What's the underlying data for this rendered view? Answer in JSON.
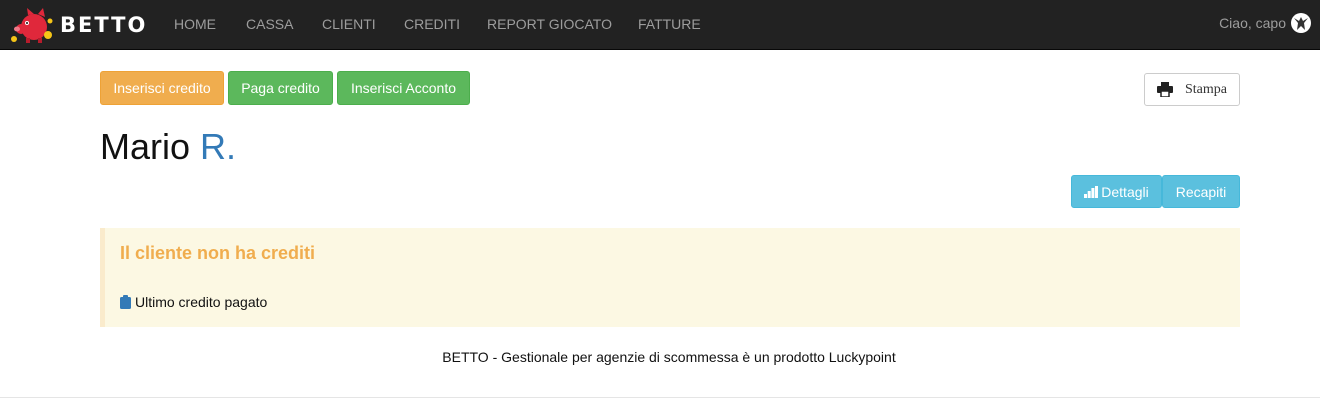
{
  "brand": {
    "name": "BETTO",
    "logo_icon": "pig-mascot-icon"
  },
  "nav": {
    "items": [
      {
        "label": "HOME"
      },
      {
        "label": "CASSA"
      },
      {
        "label": "CLIENTI"
      },
      {
        "label": "CREDITI"
      },
      {
        "label": "REPORT GIOCATO"
      },
      {
        "label": "FATTURE"
      }
    ],
    "user": {
      "greeting": "Ciao, capo",
      "icon": "user-avatar-icon"
    }
  },
  "actions": {
    "insert_credit": "Inserisci credito",
    "pay_credit": "Paga credito",
    "insert_deposit": "Inserisci Acconto",
    "print": "Stampa"
  },
  "client": {
    "first_name": "Mario",
    "surname": "R."
  },
  "client_actions": {
    "details": "Dettagli",
    "contacts": "Recapiti"
  },
  "alert": {
    "title": "Il cliente non ha crediti",
    "last_paid_label": "Ultimo credito pagato"
  },
  "footer": {
    "text": "BETTO - Gestionale per agenzie di scommessa è un prodotto Luckypoint"
  },
  "colors": {
    "navbar": "#222222",
    "nav_text": "#9d9d9d",
    "warning": "#f0ad4e",
    "success": "#5cb85c",
    "info": "#5bc0de",
    "link": "#337ab7",
    "alert_bg": "#fcf8e3"
  }
}
